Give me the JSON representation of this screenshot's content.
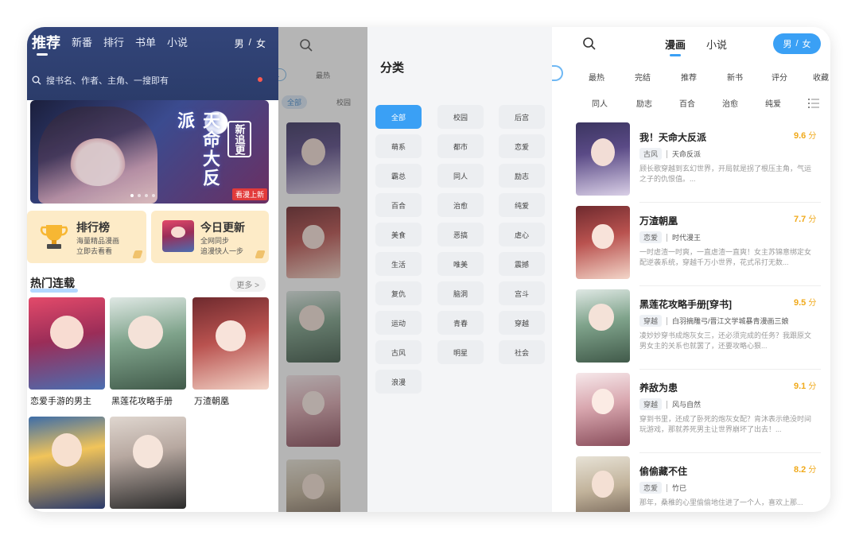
{
  "home": {
    "tabs": [
      "推荐",
      "新番",
      "排行",
      "书单",
      "小说"
    ],
    "gender": [
      "男",
      "/",
      "女"
    ],
    "search_placeholder": "搜书名、作者、主角、一搜即有",
    "banner": {
      "title": "天命大反派",
      "badge": "新追更",
      "tag": "看漫上新"
    },
    "quick_links": [
      {
        "title": "排行榜",
        "sub1": "海量精品漫画",
        "sub2": "立即去看看"
      },
      {
        "title": "今日更新",
        "sub1": "全网同步",
        "sub2": "追漫快人一步"
      }
    ],
    "section": {
      "title": "热门连载",
      "more": "更多 >"
    },
    "covers": [
      {
        "title": "恋爱手游的男主"
      },
      {
        "title": "黑莲花攻略手册"
      },
      {
        "title": "万渣朝凰"
      }
    ],
    "covers_row2_count": 2
  },
  "dimmed": {
    "chips": [
      "最热",
      "全部",
      "校园"
    ]
  },
  "category": {
    "title": "分类",
    "items": [
      "全部",
      "校园",
      "后宫",
      "萌系",
      "都市",
      "恋爱",
      "霸总",
      "同人",
      "励志",
      "百合",
      "治愈",
      "纯爱",
      "美食",
      "恶搞",
      "虐心",
      "生活",
      "唯美",
      "震撼",
      "复仇",
      "脑洞",
      "宫斗",
      "运动",
      "青春",
      "穿越",
      "古风",
      "明星",
      "社会",
      "浪漫"
    ],
    "active": "全部"
  },
  "list": {
    "tabs": [
      "漫画",
      "小说"
    ],
    "gender": [
      "男",
      "/",
      "女"
    ],
    "filters_row1": [
      "最热",
      "完结",
      "推荐",
      "新书",
      "评分",
      "收藏"
    ],
    "filters_row2": [
      "同人",
      "励志",
      "百合",
      "治愈",
      "纯爱"
    ],
    "items": [
      {
        "title": "我！天命大反派",
        "score": "9.6",
        "unit": "分",
        "genre": "古风",
        "author": "天命反派",
        "desc": "顾长歌穿越到玄幻世界，开局就是拐了根压主角，气运之子的仇恨值。..."
      },
      {
        "title": "万渣朝凰",
        "score": "7.7",
        "unit": "分",
        "genre": "恋爱",
        "author": "时代漫王",
        "desc": "一时虐渣一时爽，一直虐渣一直爽！女主苏锦意绑定女配逆袭系统，穿越千万小世界，花式吊打无数..."
      },
      {
        "title": "黑莲花攻略手册[穿书]",
        "score": "9.5",
        "unit": "分",
        "genre": "穿越",
        "author": "白羽摘雕弓/晋江文学城暴青漫画三娘",
        "desc": "凌妙妙穿书成炮灰女三，还必须完成的任务？我跟原文男女主的关系也就罢了，还要攻略心狠..."
      },
      {
        "title": "养敌为患",
        "score": "9.1",
        "unit": "分",
        "genre": "穿越",
        "author": "风与自然",
        "desc": "穿到书里，还成了卧死的炮灰女配？肯沐表示绝没时间玩游戏，那就养死男主让世界崩坏了出去！..."
      },
      {
        "title": "偷偷藏不住",
        "score": "8.2",
        "unit": "分",
        "genre": "恋爱",
        "author": "竹已",
        "desc": "那年，桑稚的心里偷偷地住进了一个人，喜欢上那..."
      }
    ]
  },
  "colors": {
    "accent": "#3aa0f5",
    "score": "#f0a91a",
    "home_header": "#33457a",
    "quick_bg": "#fdebc7"
  }
}
